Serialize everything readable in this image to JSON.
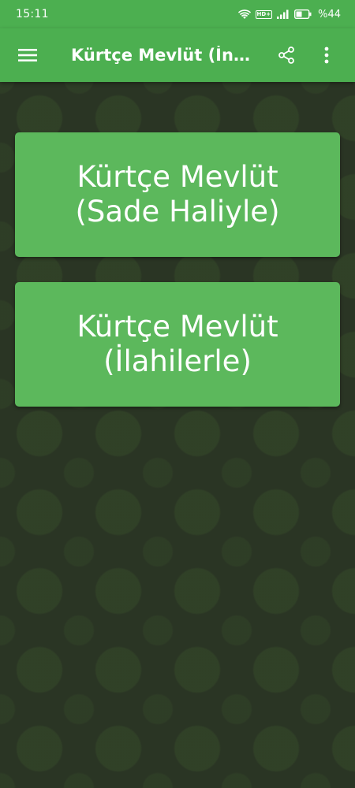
{
  "status_bar": {
    "time": "15:11",
    "network_badge": "HD+",
    "battery_percent": "%44",
    "icons": [
      "wifi-icon",
      "signal-icon",
      "battery-icon"
    ]
  },
  "app_bar": {
    "title": "Kürtçe Mevlüt (İnt…",
    "icons": [
      "hamburger-menu-icon",
      "share-icon",
      "more-vert-icon"
    ]
  },
  "cards": [
    {
      "line1": "Kürtçe Mevlüt",
      "line2": "(Sade Haliyle)"
    },
    {
      "line1": "Kürtçe Mevlüt",
      "line2": "(İlahilerle)"
    }
  ],
  "colors": {
    "primary": "#4caf50",
    "card": "#5cb85c",
    "background": "#2a3524"
  }
}
